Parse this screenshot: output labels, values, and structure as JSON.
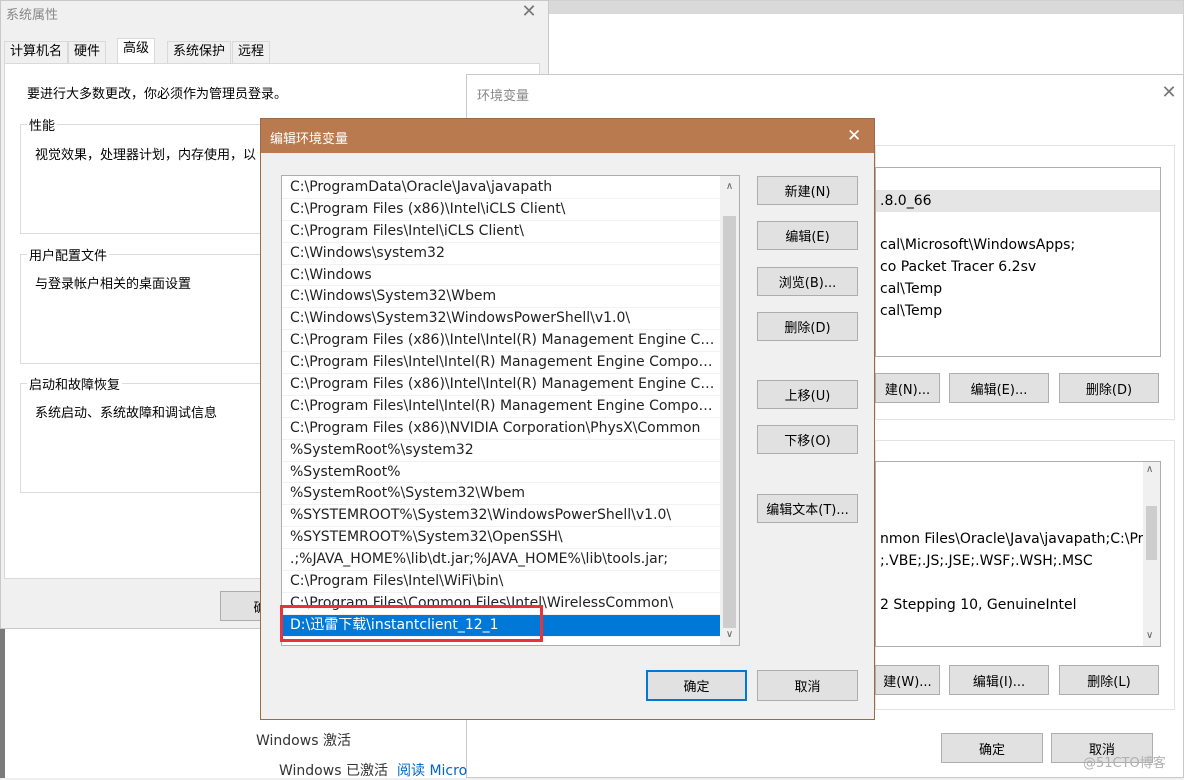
{
  "sysprops": {
    "title": "系统属性",
    "tabs": [
      "计算机名",
      "硬件",
      "高级",
      "系统保护",
      "远程"
    ],
    "admin_note": "要进行大多数更改，你必须作为管理员登录。",
    "perf_label": "性能",
    "perf_desc": "视觉效果，处理器计划，内存使用，以",
    "profile_label": "用户配置文件",
    "profile_desc": "与登录帐户相关的桌面设置",
    "startup_label": "启动和故障恢复",
    "startup_desc": "系统启动、系统故障和调试信息",
    "partial_button": "确"
  },
  "envvars": {
    "title": "环境变量",
    "user_rows": [
      ".8.0_66",
      "",
      "cal\\Microsoft\\WindowsApps;",
      "co Packet Tracer 6.2sv",
      "cal\\Temp",
      "cal\\Temp"
    ],
    "user_buttons": [
      "建(N)...",
      "编辑(E)...",
      "删除(D)"
    ],
    "sys_rows": [
      "",
      "",
      "",
      "nmon Files\\Oracle\\Java\\javapath;C:\\Pr...",
      ";.VBE;.JS;.JSE;.WSF;.WSH;.MSC",
      "",
      "2 Stepping 10, GenuineIntel"
    ],
    "sys_buttons": [
      "建(W)...",
      "编辑(I)...",
      "删除(L)"
    ],
    "ok": "确定",
    "cancel": "取消"
  },
  "dialog": {
    "title": "编辑环境变量",
    "paths": [
      "C:\\ProgramData\\Oracle\\Java\\javapath",
      "C:\\Program Files (x86)\\Intel\\iCLS Client\\",
      "C:\\Program Files\\Intel\\iCLS Client\\",
      "C:\\Windows\\system32",
      "C:\\Windows",
      "C:\\Windows\\System32\\Wbem",
      "C:\\Windows\\System32\\WindowsPowerShell\\v1.0\\",
      "C:\\Program Files (x86)\\Intel\\Intel(R) Management Engine Comp...",
      "C:\\Program Files\\Intel\\Intel(R) Management Engine Componen...",
      "C:\\Program Files (x86)\\Intel\\Intel(R) Management Engine Comp...",
      "C:\\Program Files\\Intel\\Intel(R) Management Engine Componen...",
      "C:\\Program Files (x86)\\NVIDIA Corporation\\PhysX\\Common",
      "%SystemRoot%\\system32",
      "%SystemRoot%",
      "%SystemRoot%\\System32\\Wbem",
      "%SYSTEMROOT%\\System32\\WindowsPowerShell\\v1.0\\",
      "%SYSTEMROOT%\\System32\\OpenSSH\\",
      ".;%JAVA_HOME%\\lib\\dt.jar;%JAVA_HOME%\\lib\\tools.jar;",
      "C:\\Program Files\\Intel\\WiFi\\bin\\",
      "C:\\Program Files\\Common Files\\Intel\\WirelessCommon\\",
      "D:\\迅雷下载\\instantclient_12_1"
    ],
    "selected_index": 20,
    "buttons": {
      "new": "新建(N)",
      "edit": "编辑(E)",
      "browse": "浏览(B)...",
      "delete": "删除(D)",
      "move_up": "上移(U)",
      "move_down": "下移(O)",
      "edit_text": "编辑文本(T)..."
    },
    "ok": "确定",
    "cancel": "取消"
  },
  "activation": {
    "title": "Windows 激活",
    "status": "Windows 已激活",
    "link": "阅读 Micro"
  },
  "watermark": "@51CTO博客",
  "colors": {
    "dialog_titlebar": "#b87a4e",
    "selection": "#0078d7",
    "highlight": "#e8323c"
  }
}
